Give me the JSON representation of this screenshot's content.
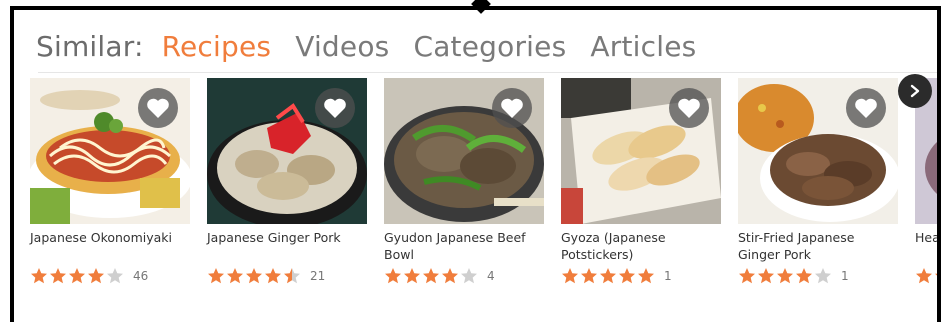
{
  "tabs": {
    "label": "Similar:",
    "items": [
      {
        "label": "Recipes",
        "active": true
      },
      {
        "label": "Videos",
        "active": false
      },
      {
        "label": "Categories",
        "active": false
      },
      {
        "label": "Articles",
        "active": false
      }
    ]
  },
  "accent_color": "#f07d3c",
  "cards": [
    {
      "title": "Japanese Okonomiyaki",
      "rating": 4,
      "count": "46",
      "icon": "heart-icon"
    },
    {
      "title": "Japanese Ginger Pork",
      "rating": 4.5,
      "count": "21",
      "icon": "heart-icon"
    },
    {
      "title": "Gyudon Japanese Beef Bowl",
      "rating": 4,
      "count": "4",
      "icon": "heart-icon"
    },
    {
      "title": "Gyoza (Japanese Potstickers)",
      "rating": 5,
      "count": "1",
      "icon": "heart-icon"
    },
    {
      "title": "Stir-Fried Japanese Ginger Pork",
      "rating": 4,
      "count": "1",
      "icon": "heart-icon"
    },
    {
      "title": "Heal Pane",
      "rating": 5,
      "count": "",
      "icon": "heart-icon"
    }
  ],
  "next_button": {
    "icon": "chevron-right-icon"
  }
}
